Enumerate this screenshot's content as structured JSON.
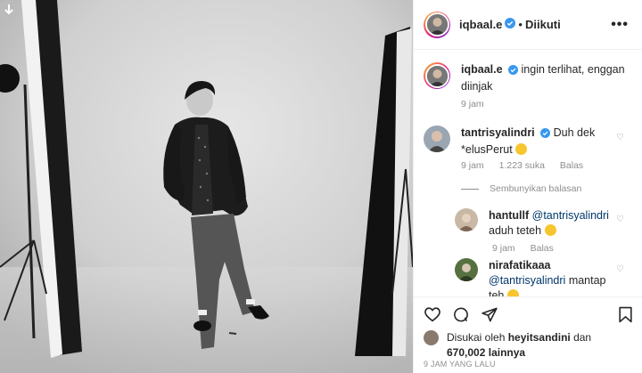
{
  "header": {
    "username": "iqbaal.e",
    "separator": "•",
    "follow_status": "Diikuti",
    "more": "•••"
  },
  "caption": {
    "username": "iqbaal.e",
    "text": "ingin terlihat, enggan diinjak",
    "time": "9 jam"
  },
  "comments": [
    {
      "username": "tantrisyalindri",
      "text": "Duh dek *elusPerut",
      "time": "9 jam",
      "likes": "1.223 suka",
      "reply": "Balas",
      "hide_replies": "Sembunyikan balasan"
    },
    {
      "username": "hantullf",
      "mention": "@tantrisyalindri",
      "text": "aduh teteh",
      "time": "9 jam",
      "reply": "Balas"
    },
    {
      "username": "nirafatikaaa",
      "mention": "@tantrisyalindri",
      "text": "mantap teh"
    }
  ],
  "likes": {
    "prefix": "Disukai oleh",
    "user": "heyitsandini",
    "connector": "dan",
    "count": "670,002",
    "suffix": "lainnya"
  },
  "timestamp": "9 JAM YANG LALU",
  "colors": {
    "verified": "#3897f0",
    "text": "#262626",
    "secondary": "#8e8e8e",
    "mention": "#00376b"
  },
  "icons": [
    "download-icon",
    "verified-icon",
    "more-icon",
    "heart-icon",
    "comment-icon",
    "share-icon",
    "bookmark-icon"
  ]
}
